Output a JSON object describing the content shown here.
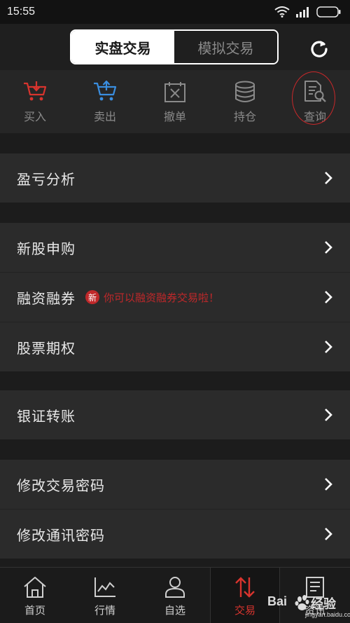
{
  "status_bar": {
    "time": "15:55"
  },
  "header": {
    "tabs": [
      {
        "label": "实盘交易",
        "active": true
      },
      {
        "label": "模拟交易",
        "active": false
      }
    ]
  },
  "quick_actions": [
    {
      "label": "买入",
      "icon": "cart-buy-icon",
      "color": "#d8342e"
    },
    {
      "label": "卖出",
      "icon": "cart-sell-icon",
      "color": "#3a8ee0"
    },
    {
      "label": "撤单",
      "icon": "cancel-order-icon",
      "color": "#8a8a8a"
    },
    {
      "label": "持仓",
      "icon": "holdings-stack-icon",
      "color": "#8a8a8a"
    },
    {
      "label": "查询",
      "icon": "query-document-icon",
      "color": "#8a8a8a"
    }
  ],
  "menu": {
    "profit_analysis": "盈亏分析",
    "ipo_subscribe": "新股申购",
    "margin_trading": "融资融券",
    "margin_badge": "新",
    "margin_promo": "你可以融资融券交易啦！",
    "stock_options": "股票期权",
    "bank_transfer": "银证转账",
    "change_trade_password": "修改交易密码",
    "change_comm_password": "修改通讯密码"
  },
  "tab_bar": [
    {
      "label": "首页",
      "icon": "home-icon",
      "active": false
    },
    {
      "label": "行情",
      "icon": "market-chart-icon",
      "active": false
    },
    {
      "label": "自选",
      "icon": "watchlist-user-icon",
      "active": false
    },
    {
      "label": "交易",
      "icon": "trade-arrows-icon",
      "active": true
    },
    {
      "label": "资讯",
      "icon": "news-icon",
      "active": false
    }
  ],
  "colors": {
    "accent_red": "#d8342e",
    "accent_blue": "#3a8ee0",
    "background": "#1c1c1c",
    "row": "#2b2b2b"
  },
  "watermark": {
    "brand": "Bai",
    "brand_cn": "经验",
    "url": "jingyan.baidu.com"
  }
}
